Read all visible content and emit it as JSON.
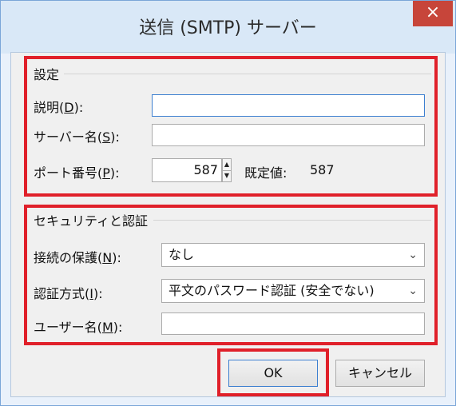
{
  "window": {
    "title": "送信 (SMTP) サーバー",
    "close_glyph": "×"
  },
  "settings_group": {
    "title": "設定",
    "description_label": {
      "text": "説明(",
      "accel": "D",
      "suffix": "):"
    },
    "description_value": "",
    "server_name_label": {
      "text": "サーバー名(",
      "accel": "S",
      "suffix": "):"
    },
    "server_name_value": "",
    "port_label": {
      "text": "ポート番号(",
      "accel": "P",
      "suffix": "):"
    },
    "port_value": "587",
    "default_label": "既定値:",
    "default_value": "587"
  },
  "security_group": {
    "title": "セキュリティと認証",
    "protection_label": {
      "text": "接続の保護(",
      "accel": "N",
      "suffix": "):"
    },
    "protection_value": "なし",
    "auth_label": {
      "text": "認証方式(",
      "accel": "I",
      "suffix": "):"
    },
    "auth_value": "平文のパスワード認証 (安全でない)",
    "username_label": {
      "text": "ユーザー名(",
      "accel": "M",
      "suffix": "):"
    },
    "username_value": ""
  },
  "buttons": {
    "ok": "OK",
    "cancel": "キャンセル"
  },
  "colors": {
    "highlight": "#e0202a",
    "close_button": "#c7453a",
    "focus_border": "#3c7fd0"
  },
  "icons": {
    "spin_up": "▲",
    "spin_down": "▼",
    "dropdown": "⌄"
  }
}
